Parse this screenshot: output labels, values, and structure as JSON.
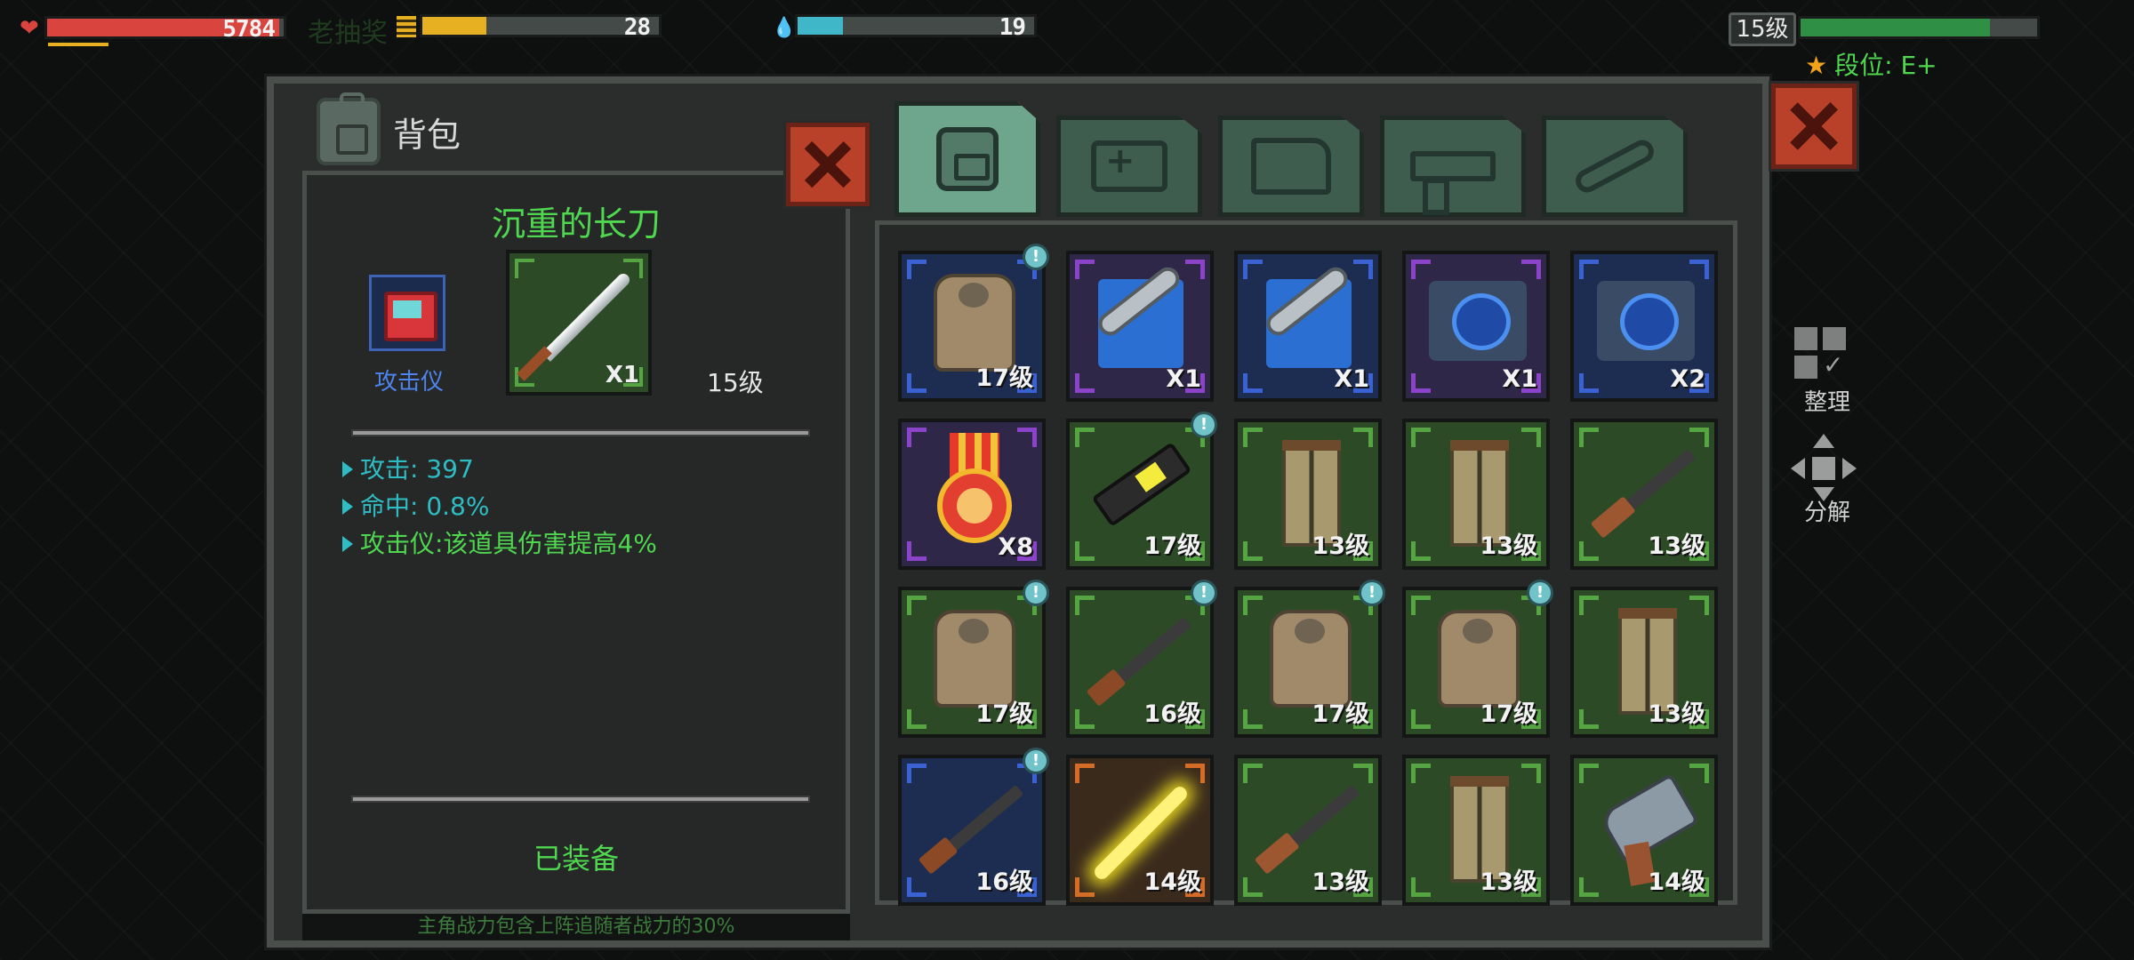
{
  "hud": {
    "health": {
      "value": "5784",
      "fill": 0.98
    },
    "faded_text": "老抽奖",
    "energy": {
      "value": "28",
      "fill": 0.27
    },
    "water": {
      "value": "19",
      "fill": 0.19
    },
    "level": "15级",
    "xp_fill": 0.8,
    "rank": "段位: E+"
  },
  "bag": {
    "title": "背包"
  },
  "tabs": [
    {
      "icon": "backpack-icon",
      "active": true
    },
    {
      "icon": "medkit-icon",
      "active": false
    },
    {
      "icon": "armor-icon",
      "active": false
    },
    {
      "icon": "gun-icon",
      "active": false
    },
    {
      "icon": "wrench-icon",
      "active": false
    }
  ],
  "detail": {
    "item_name": "沉重的长刀",
    "attachment_label": "攻击仪",
    "quantity": "X1",
    "level": "15级",
    "stats": [
      "攻击: 397",
      "命中: 0.8%",
      "攻击仪:该道具伤害提高4%"
    ],
    "status": "已装备",
    "bottom_note": "主角战力包含上阵追随者战力的30%"
  },
  "inventory": [
    {
      "item": "tactical-vest",
      "label": "17级",
      "rarity": "blue",
      "new": true
    },
    {
      "item": "wrench-kit",
      "label": "X1",
      "rarity": "purple",
      "new": false
    },
    {
      "item": "wrench-kit",
      "label": "X1",
      "rarity": "blue",
      "new": false
    },
    {
      "item": "chip-module",
      "label": "X1",
      "rarity": "purple",
      "new": false
    },
    {
      "item": "chip-module",
      "label": "X2",
      "rarity": "blue",
      "new": false
    },
    {
      "item": "medal",
      "label": "X8",
      "rarity": "purple",
      "new": false
    },
    {
      "item": "laser-gun",
      "label": "17级",
      "rarity": "green",
      "new": true
    },
    {
      "item": "pants",
      "label": "13级",
      "rarity": "green",
      "new": false
    },
    {
      "item": "pants",
      "label": "13级",
      "rarity": "green",
      "new": false
    },
    {
      "item": "shotgun",
      "label": "13级",
      "rarity": "green",
      "new": false
    },
    {
      "item": "tactical-vest",
      "label": "17级",
      "rarity": "green",
      "new": true
    },
    {
      "item": "assault-rifle",
      "label": "16级",
      "rarity": "green",
      "new": true
    },
    {
      "item": "tactical-vest",
      "label": "17级",
      "rarity": "green",
      "new": true
    },
    {
      "item": "tactical-vest",
      "label": "17级",
      "rarity": "green",
      "new": true
    },
    {
      "item": "pants",
      "label": "13级",
      "rarity": "green",
      "new": false
    },
    {
      "item": "assault-rifle",
      "label": "16级",
      "rarity": "blue",
      "new": true
    },
    {
      "item": "light-saber",
      "label": "14级",
      "rarity": "orange",
      "new": false
    },
    {
      "item": "shotgun",
      "label": "13级",
      "rarity": "green",
      "new": false
    },
    {
      "item": "pants",
      "label": "13级",
      "rarity": "green",
      "new": false
    },
    {
      "item": "revolver",
      "label": "14级",
      "rarity": "green",
      "new": false
    }
  ],
  "side": {
    "sort_label": "整理",
    "split_label": "分解"
  },
  "colors": {
    "health": "#d9443f",
    "energy": "#e6b022",
    "water": "#3fb7c9",
    "xp": "#2f8f45",
    "green_text": "#4fd84f",
    "stat_text": "#2fbdc5"
  }
}
